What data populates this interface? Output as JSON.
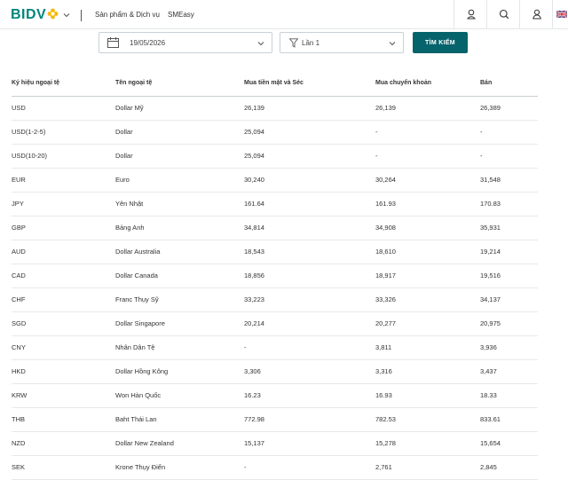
{
  "header": {
    "logo_text": "BIDV",
    "nav": [
      "Sản phẩm & Dịch vụ",
      "SMEasy"
    ],
    "icons": [
      "user-branch-icon",
      "search-icon",
      "user-account-icon",
      "uk-flag-icon"
    ],
    "brand_color": "#00857c",
    "accent_color": "#05636b"
  },
  "filters": {
    "date_value": "19/05/2026",
    "round_value": "Lần 1",
    "search_label": "TÌM KIẾM"
  },
  "table": {
    "headers": [
      "Ký hiệu ngoại tệ",
      "Tên ngoại tệ",
      "Mua tiền mặt và Séc",
      "Mua chuyển khoản",
      "Bán"
    ],
    "rows": [
      [
        "USD",
        "Dollar Mỹ",
        "26,139",
        "26,139",
        "26,389"
      ],
      [
        "USD(1-2-5)",
        "Dollar",
        "25,094",
        "-",
        "-"
      ],
      [
        "USD(10-20)",
        "Dollar",
        "25,094",
        "-",
        "-"
      ],
      [
        "EUR",
        "Euro",
        "30,240",
        "30,264",
        "31,548"
      ],
      [
        "JPY",
        "Yên Nhật",
        "161.64",
        "161.93",
        "170.83"
      ],
      [
        "GBP",
        "Bảng Anh",
        "34,814",
        "34,908",
        "35,931"
      ],
      [
        "AUD",
        "Dollar Australia",
        "18,543",
        "18,610",
        "19,214"
      ],
      [
        "CAD",
        "Dollar Canada",
        "18,856",
        "18,917",
        "19,516"
      ],
      [
        "CHF",
        "Franc Thụy Sỹ",
        "33,223",
        "33,326",
        "34,137"
      ],
      [
        "SGD",
        "Dollar Singapore",
        "20,214",
        "20,277",
        "20,975"
      ],
      [
        "CNY",
        "Nhân Dân Tệ",
        "-",
        "3,811",
        "3,936"
      ],
      [
        "HKD",
        "Dollar Hồng Kông",
        "3,306",
        "3,316",
        "3,437"
      ],
      [
        "KRW",
        "Won Hàn Quốc",
        "16.23",
        "16.93",
        "18.33"
      ],
      [
        "THB",
        "Baht Thái Lan",
        "772.98",
        "782.53",
        "833.61"
      ],
      [
        "NZD",
        "Dollar New Zealand",
        "15,137",
        "15,278",
        "15,654"
      ],
      [
        "SEK",
        "Krone Thụy Điển",
        "-",
        "2,761",
        "2,845"
      ]
    ]
  }
}
